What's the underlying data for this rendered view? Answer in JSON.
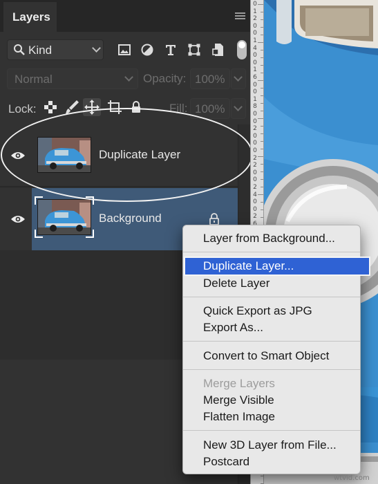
{
  "panel": {
    "tab_label": "Layers",
    "filter": {
      "kind_label": "Kind"
    },
    "blend_mode": "Normal",
    "opacity_label": "Opacity:",
    "opacity_value": "100%",
    "lock_label": "Lock:",
    "fill_label": "Fill:",
    "fill_value": "100%",
    "icons": {
      "filter": [
        "image-filter-icon",
        "adjustment-filter-icon",
        "type-filter-icon",
        "shape-filter-icon",
        "smart-object-filter-icon"
      ],
      "lock": [
        "lock-transparent-pixels-icon",
        "lock-image-pixels-icon",
        "lock-position-icon",
        "artboard-lock-icon",
        "lock-all-icon"
      ]
    }
  },
  "layers": [
    {
      "name": "Duplicate Layer",
      "visible": true,
      "selected": false,
      "locked": false
    },
    {
      "name": "Background",
      "visible": true,
      "selected": true,
      "locked": true
    }
  ],
  "context_menu": {
    "items": [
      {
        "label": "Layer from Background...",
        "enabled": true
      },
      {
        "label": "Duplicate Layer...",
        "enabled": true,
        "highlighted": true
      },
      {
        "label": "Delete Layer",
        "enabled": true
      },
      {
        "label": "Quick Export as JPG",
        "enabled": true
      },
      {
        "label": "Export As...",
        "enabled": true
      },
      {
        "label": "Convert to Smart Object",
        "enabled": true
      },
      {
        "label": "Merge Layers",
        "enabled": false
      },
      {
        "label": "Merge Visible",
        "enabled": true
      },
      {
        "label": "Flatten Image",
        "enabled": true
      },
      {
        "label": "New 3D Layer from File...",
        "enabled": true
      },
      {
        "label": "Postcard",
        "enabled": true
      }
    ]
  },
  "ruler": {
    "labels": [
      "0",
      "1",
      "2",
      "0",
      "0",
      "1",
      "4",
      "0",
      "0",
      "1",
      "6",
      "0",
      "0",
      "1",
      "8",
      "0",
      "0",
      "2",
      "0",
      "0",
      "0",
      "2",
      "2",
      "0",
      "0",
      "2",
      "4",
      "0",
      "0",
      "2",
      "6"
    ]
  },
  "watermark": "wtvid.com",
  "colors": {
    "highlight": "#2f62d4",
    "selected_layer": "#3f5a78",
    "car_blue": "#3b8fd0"
  }
}
